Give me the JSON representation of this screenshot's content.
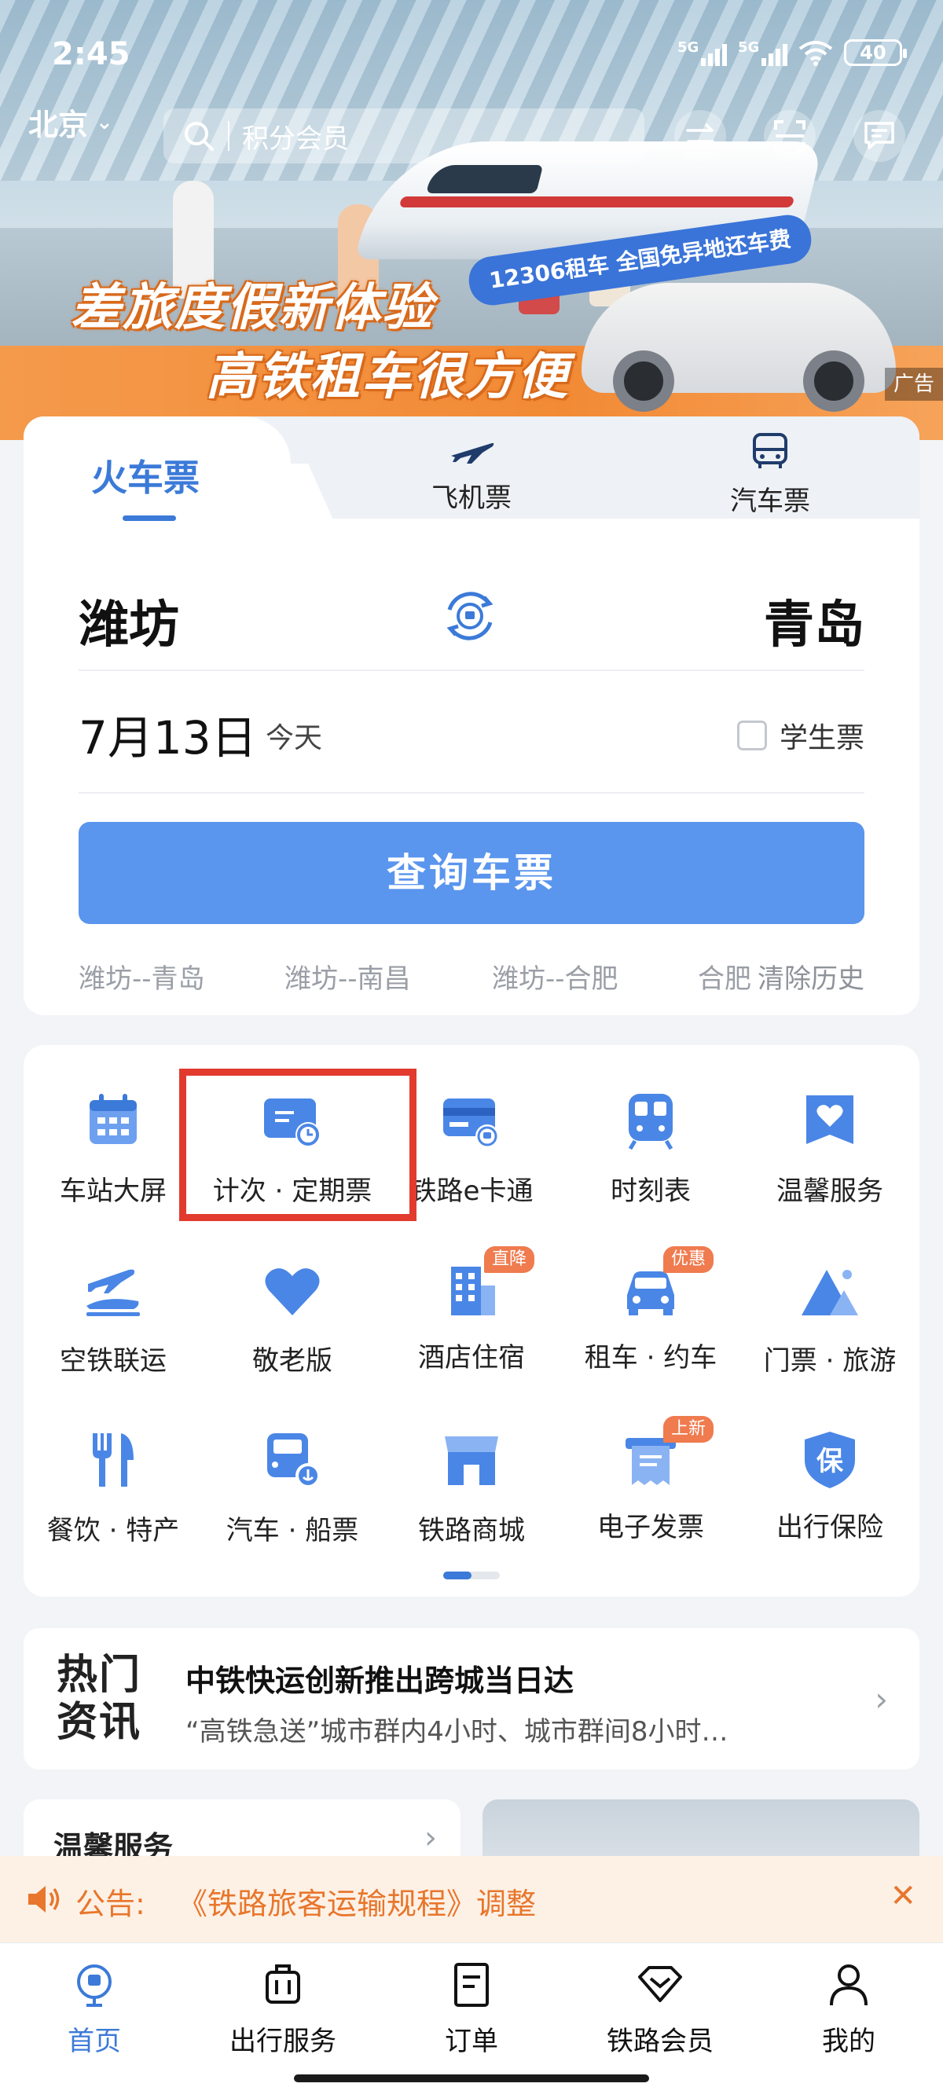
{
  "status_bar": {
    "time": "2:45",
    "network_1": "5G",
    "network_2": "5G",
    "battery": "40"
  },
  "banner": {
    "headline_1": "差旅度假新体验",
    "headline_2": "高铁租车很方便",
    "promo_tag": "12306租车 全国免异地还车费",
    "ad_label": "广告"
  },
  "top_bar": {
    "city": "北京",
    "search_placeholder": "积分会员"
  },
  "ticket_tabs": [
    {
      "label": "火车票",
      "icon": "train-icon",
      "active": true
    },
    {
      "label": "飞机票",
      "icon": "airplane-icon",
      "active": false
    },
    {
      "label": "汽车票",
      "icon": "bus-icon",
      "active": false
    }
  ],
  "booking": {
    "from": "潍坊",
    "to": "青岛",
    "date": "7月13日",
    "date_hint": "今天",
    "student_ticket": "学生票",
    "student_checked": false,
    "query_button": "查询车票",
    "history": [
      "潍坊--青岛",
      "潍坊--南昌",
      "潍坊--合肥",
      "合肥"
    ],
    "clear_history": "清除历史"
  },
  "services": [
    {
      "label": "车站大屏",
      "icon": "calendar-icon"
    },
    {
      "label": "计次 · 定期票",
      "icon": "card-clock-icon",
      "highlighted": true
    },
    {
      "label": "铁路e卡通",
      "icon": "rail-card-icon"
    },
    {
      "label": "时刻表",
      "icon": "schedule-train-icon"
    },
    {
      "label": "温馨服务",
      "icon": "heart-service-icon"
    },
    {
      "label": "空铁联运",
      "icon": "air-rail-icon"
    },
    {
      "label": "敬老版",
      "icon": "heart-icon"
    },
    {
      "label": "酒店住宿",
      "icon": "hotel-icon",
      "badge": "直降"
    },
    {
      "label": "租车 · 约车",
      "icon": "car-icon",
      "badge": "优惠"
    },
    {
      "label": "门票 · 旅游",
      "icon": "mountain-icon"
    },
    {
      "label": "餐饮 · 特产",
      "icon": "dining-icon"
    },
    {
      "label": "汽车 · 船票",
      "icon": "bus-ship-icon"
    },
    {
      "label": "铁路商城",
      "icon": "shop-icon"
    },
    {
      "label": "电子发票",
      "icon": "invoice-icon",
      "badge": "上新"
    },
    {
      "label": "出行保险",
      "icon": "insurance-icon",
      "badge_text": "保"
    }
  ],
  "pager": {
    "current": 1,
    "total": 2
  },
  "news": {
    "logo": "热门资讯",
    "logo_line1": "热门",
    "logo_line2": "资讯",
    "title": "中铁快运创新推出跨城当日达",
    "subtitle": "“高铁急送”城市群内4小时、城市群间8小时…"
  },
  "warm_service": {
    "title": "温馨服务"
  },
  "notice": {
    "label": "公告:",
    "text": "《铁路旅客运输规程》调整"
  },
  "bottom_nav": [
    {
      "label": "首页",
      "icon": "home-rail-icon",
      "active": true
    },
    {
      "label": "出行服务",
      "icon": "luggage-icon",
      "active": false
    },
    {
      "label": "订单",
      "icon": "order-icon",
      "active": false
    },
    {
      "label": "铁路会员",
      "icon": "member-diamond-icon",
      "active": false
    },
    {
      "label": "我的",
      "icon": "profile-icon",
      "active": false
    }
  ],
  "colors": {
    "accent": "#3b7ad8",
    "query_button": "#5a95ee",
    "highlight_border": "#e23b2e",
    "notice_text": "#e8762c",
    "badge": "#ef7b4f"
  }
}
